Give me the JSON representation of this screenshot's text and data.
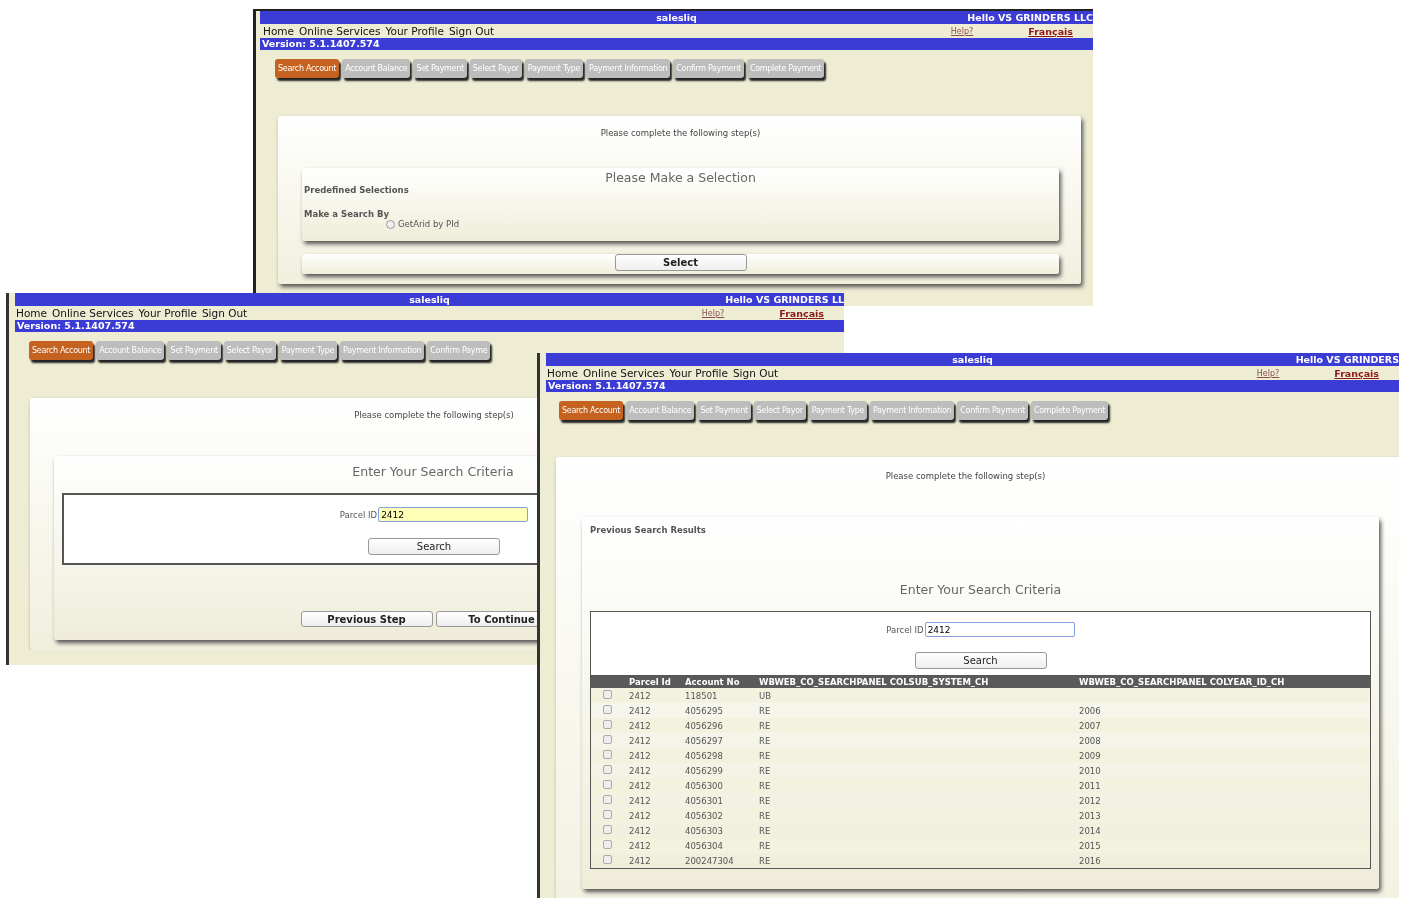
{
  "windows": [
    {
      "kind": "selection",
      "title": "salesliq",
      "greeting": "Hello VS GRINDERS LLC",
      "nav": [
        "Home",
        "Online Services",
        "Your Profile",
        "Sign Out"
      ],
      "help": "Help?",
      "language": "Français",
      "version": "Version: 5.1.1407.574",
      "tabs": [
        {
          "label": "Search Account",
          "selected": true
        },
        {
          "label": "Account Balance",
          "selected": false
        },
        {
          "label": "Set Payment",
          "selected": false
        },
        {
          "label": "Select Payor",
          "selected": false
        },
        {
          "label": "Payment Type",
          "selected": false
        },
        {
          "label": "Payment Information",
          "selected": false
        },
        {
          "label": "Confirm Payment",
          "selected": false
        },
        {
          "label": "Complete Payment",
          "selected": false
        }
      ],
      "prompt": "Please complete the following step(s)",
      "panel_title": "Please Make a Selection",
      "predefined": "Predefined Selections",
      "search_by": "Make a Search By",
      "options": [
        {
          "label": "GetArid by PId",
          "selected": false
        }
      ],
      "action": "Select"
    },
    {
      "kind": "search",
      "title": "salesliq",
      "greeting": "Hello VS GRINDERS LL",
      "nav": [
        "Home",
        "Online Services",
        "Your Profile",
        "Sign Out"
      ],
      "help": "Help?",
      "language": "Français",
      "version": "Version: 5.1.1407.574",
      "tabs": [
        {
          "label": "Search Account",
          "selected": true
        },
        {
          "label": "Account Balance",
          "selected": false
        },
        {
          "label": "Set Payment",
          "selected": false
        },
        {
          "label": "Select Payor",
          "selected": false
        },
        {
          "label": "Payment Type",
          "selected": false
        },
        {
          "label": "Payment Information",
          "selected": false
        },
        {
          "label": "Confirm Payme",
          "selected": false
        }
      ],
      "prompt": "Please complete the following step(s)",
      "panel_title": "Enter Your Search Criteria",
      "field": {
        "label": "Parcel ID",
        "value": "2412",
        "focused": true
      },
      "search": "Search",
      "buttons": [
        "Previous Step",
        "To Continue"
      ]
    },
    {
      "kind": "results",
      "title": "salesliq",
      "greeting": "Hello VS GRINDERS",
      "nav": [
        "Home",
        "Online Services",
        "Your Profile",
        "Sign Out"
      ],
      "help": "Help?",
      "language": "Français",
      "version": "Version: 5.1.1407.574",
      "tabs": [
        {
          "label": "Search Account",
          "selected": true
        },
        {
          "label": "Account Balance",
          "selected": false
        },
        {
          "label": "Set Payment",
          "selected": false
        },
        {
          "label": "Select Payor",
          "selected": false
        },
        {
          "label": "Payment Type",
          "selected": false
        },
        {
          "label": "Payment Information",
          "selected": false
        },
        {
          "label": "Confirm Payment",
          "selected": false
        },
        {
          "label": "Complete Payment",
          "selected": false
        }
      ],
      "prompt": "Please complete the following step(s)",
      "previous": "Previous Search Results",
      "panel_title": "Enter Your Search Criteria",
      "field": {
        "label": "Parcel ID",
        "value": "2412",
        "focused": false
      },
      "search": "Search",
      "table": {
        "columns": [
          "Parcel Id",
          "Account No",
          "WBWEB_CO_SEARCHPANEL COLSUB_SYSTEM_CH",
          "WBWEB_CO_SEARCHPANEL COLYEAR_ID_CH"
        ],
        "rows": [
          {
            "checked": false,
            "cells": [
              "2412",
              "118501",
              "UB",
              ""
            ]
          },
          {
            "checked": false,
            "cells": [
              "2412",
              "4056295",
              "RE",
              "2006"
            ]
          },
          {
            "checked": false,
            "cells": [
              "2412",
              "4056296",
              "RE",
              "2007"
            ]
          },
          {
            "checked": false,
            "cells": [
              "2412",
              "4056297",
              "RE",
              "2008"
            ]
          },
          {
            "checked": false,
            "cells": [
              "2412",
              "4056298",
              "RE",
              "2009"
            ]
          },
          {
            "checked": false,
            "cells": [
              "2412",
              "4056299",
              "RE",
              "2010"
            ]
          },
          {
            "checked": false,
            "cells": [
              "2412",
              "4056300",
              "RE",
              "2011"
            ]
          },
          {
            "checked": false,
            "cells": [
              "2412",
              "4056301",
              "RE",
              "2012"
            ]
          },
          {
            "checked": false,
            "cells": [
              "2412",
              "4056302",
              "RE",
              "2013"
            ]
          },
          {
            "checked": false,
            "cells": [
              "2412",
              "4056303",
              "RE",
              "2014"
            ]
          },
          {
            "checked": false,
            "cells": [
              "2412",
              "4056304",
              "RE",
              "2015"
            ]
          },
          {
            "checked": false,
            "cells": [
              "2412",
              "200247304",
              "RE",
              "2016"
            ]
          }
        ]
      }
    }
  ]
}
